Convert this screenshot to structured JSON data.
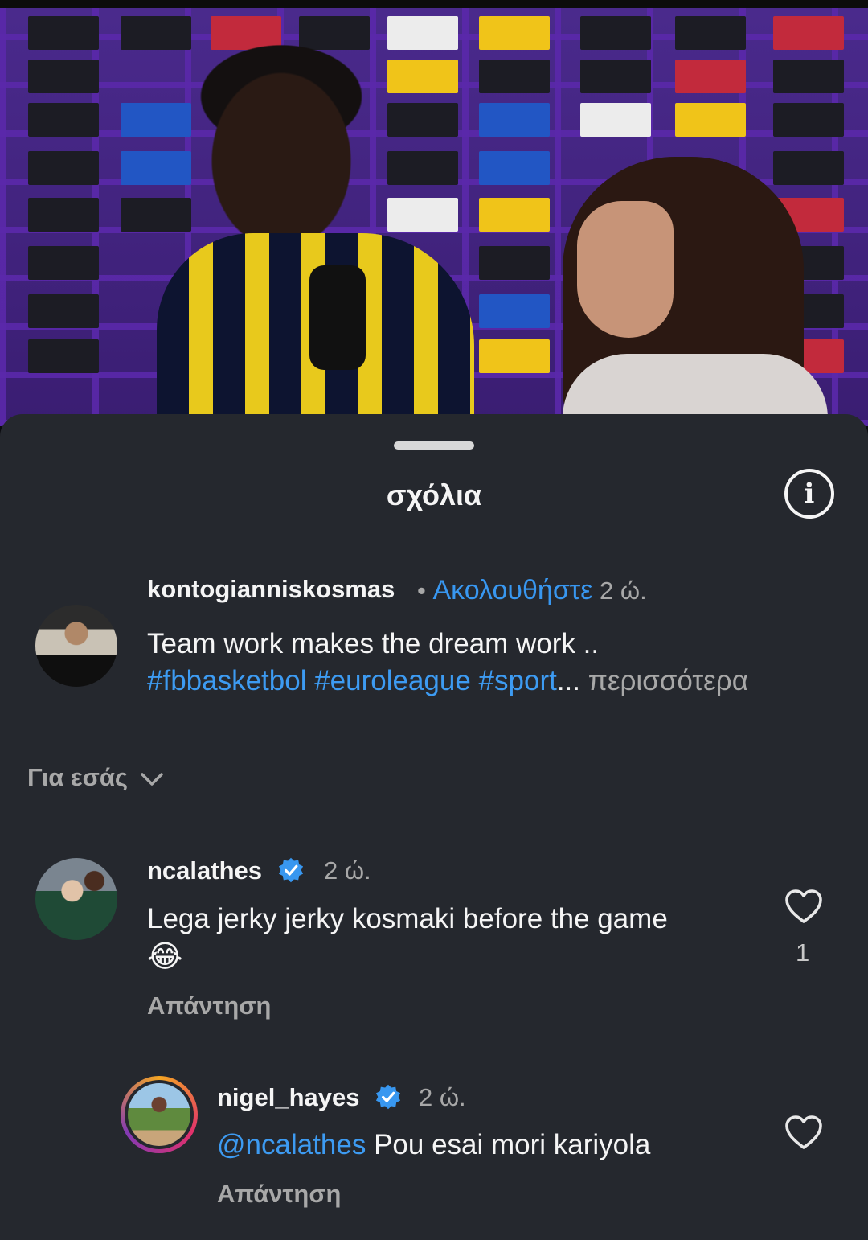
{
  "sheet": {
    "title": "σχόλια"
  },
  "caption": {
    "username": "kontogianniskosmas",
    "separator": "•",
    "follow_label": "Ακολουθήστε",
    "time": "2 ώ.",
    "text_line1": "Team work makes the dream work ..",
    "hashtags": "#fbbasketbol #euroleague #sport",
    "ellipsis": "...",
    "more_label": "περισσότερα"
  },
  "sort": {
    "label": "Για εσάς"
  },
  "comments": [
    {
      "username": "ncalathes",
      "time": "2 ώ.",
      "text": "Lega jerky jerky kosmaki before the game",
      "emoji": "😂",
      "like_count": "1",
      "reply_label": "Απάντηση"
    },
    {
      "username": "nigel_hayes",
      "time": "2 ώ.",
      "mention": "@ncalathes",
      "text": " Pou esai mori kariyola",
      "reply_label": "Απάντηση"
    }
  ],
  "colors": {
    "accent_blue": "#3897f0",
    "sheet_bg": "#25282e",
    "muted_text": "#a8a8a8"
  }
}
